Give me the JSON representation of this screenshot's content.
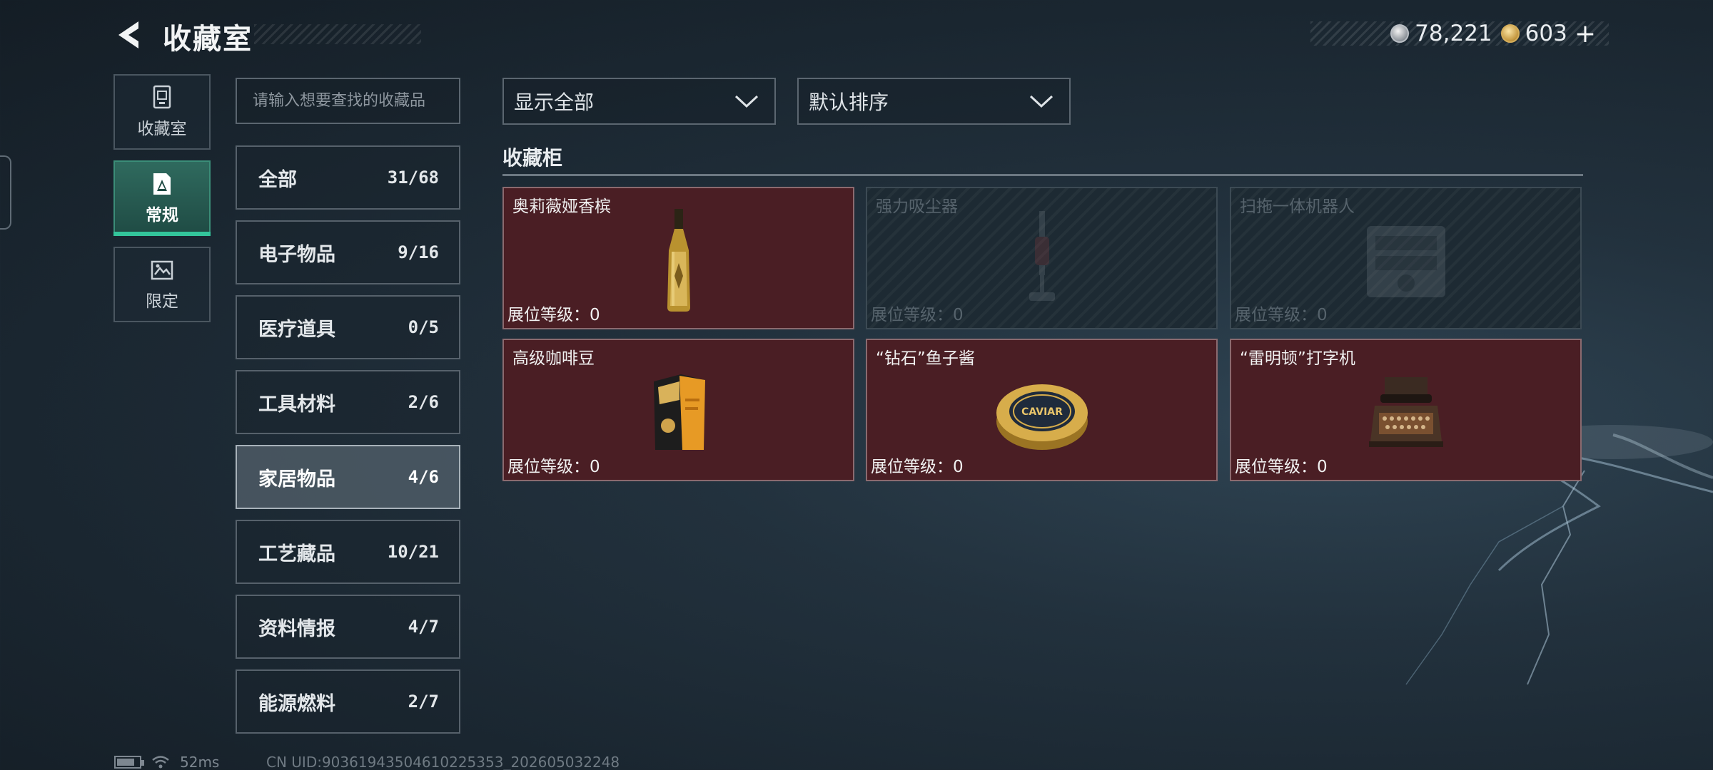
{
  "header": {
    "title": "收藏室",
    "back_icon": "back-arrow-icon"
  },
  "currency": {
    "silver_value": "78,221",
    "gold_value": "603",
    "plus_label": "+"
  },
  "nav": {
    "items": [
      {
        "label": "收藏室",
        "icon": "cabinet-icon",
        "active": false
      },
      {
        "label": "常规",
        "icon": "regular-collection-icon",
        "active": true
      },
      {
        "label": "限定",
        "icon": "limited-collection-icon",
        "active": false
      }
    ]
  },
  "search": {
    "placeholder": "请输入想要查找的收藏品"
  },
  "categories": [
    {
      "name": "全部",
      "count": "31/68",
      "active": false
    },
    {
      "name": "电子物品",
      "count": "9/16",
      "active": false
    },
    {
      "name": "医疗道具",
      "count": "0/5",
      "active": false
    },
    {
      "name": "工具材料",
      "count": "2/6",
      "active": false
    },
    {
      "name": "家居物品",
      "count": "4/6",
      "active": true
    },
    {
      "name": "工艺藏品",
      "count": "10/21",
      "active": false
    },
    {
      "name": "资料情报",
      "count": "4/7",
      "active": false
    },
    {
      "name": "能源燃料",
      "count": "2/7",
      "active": false
    }
  ],
  "filters": {
    "show_label": "显示全部",
    "sort_label": "默认排序"
  },
  "cabinet": {
    "title": "收藏柜",
    "items": [
      {
        "name": "奥莉薇娅香槟",
        "level": "展位等级：0",
        "unlocked": true,
        "art": "champagne-bottle-image"
      },
      {
        "name": "强力吸尘器",
        "level": "展位等级：0",
        "unlocked": false,
        "art": "vacuum-cleaner-image"
      },
      {
        "name": "扫拖一体机器人",
        "level": "展位等级：0",
        "unlocked": false,
        "art": "mop-robot-image"
      },
      {
        "name": "高级咖啡豆",
        "level": "展位等级：0",
        "unlocked": true,
        "art": "coffee-bag-image"
      },
      {
        "name": "“钻石”鱼子酱",
        "level": "展位等级：0",
        "unlocked": true,
        "art": "caviar-tin-image"
      },
      {
        "name": "“雷明顿”打字机",
        "level": "展位等级：0",
        "unlocked": true,
        "art": "typewriter-image"
      }
    ],
    "caviar_tin_text": "CAVIAR"
  },
  "status": {
    "ping": "52ms",
    "uid": "CN UID:90361943504610225353_202605032248"
  },
  "colors": {
    "accent_green": "#33c59b",
    "unlocked_card": "#4a1e24",
    "background": "#1a2630"
  }
}
